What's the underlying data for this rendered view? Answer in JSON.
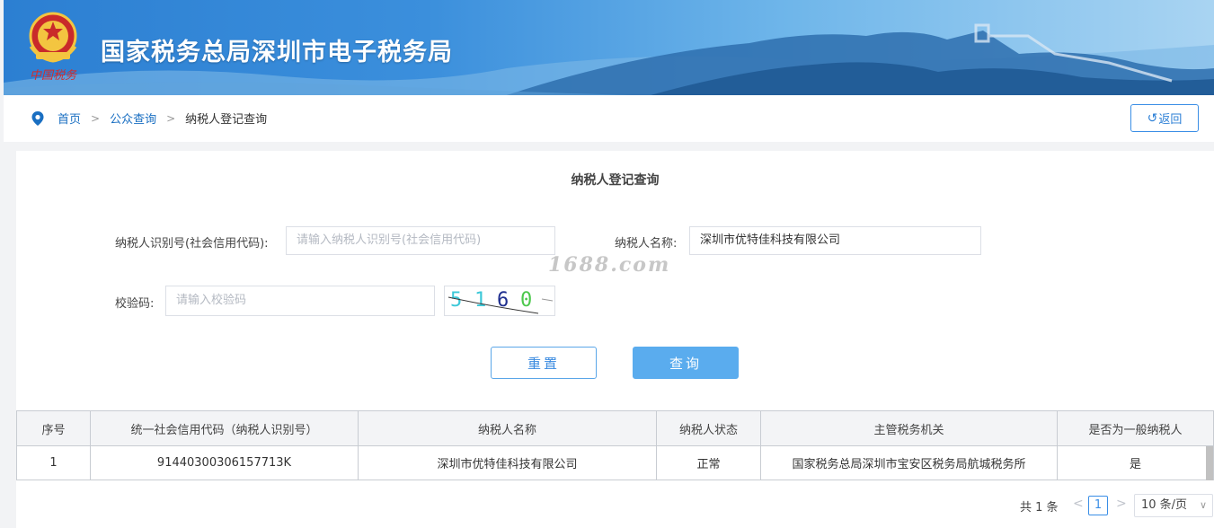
{
  "header": {
    "title": "国家税务总局深圳市电子税务局",
    "logo_caption": "中国税务"
  },
  "breadcrumb": {
    "home": "首页",
    "sep": ">",
    "public_query": "公众查询",
    "current": "纳税人登记查询",
    "back_label": "返回",
    "back_icon": "↺"
  },
  "form": {
    "title": "纳税人登记查询",
    "taxpayer_id_label": "纳税人识别号(社会信用代码):",
    "taxpayer_id_placeholder": "请输入纳税人识别号(社会信用代码)",
    "taxpayer_name_label": "纳税人名称:",
    "taxpayer_name_value": "深圳市优特佳科技有限公司",
    "captcha_label": "校验码:",
    "captcha_placeholder": "请输入校验码",
    "captcha_chars": [
      "5",
      "1",
      "6",
      "0"
    ],
    "captcha_colors": [
      "#3cc8d8",
      "#3cc8d8",
      "#1f2f8f",
      "#4cc84c"
    ],
    "reset_label": "重置",
    "query_label": "查询"
  },
  "watermark": "1688.com",
  "table": {
    "headers": [
      "序号",
      "统一社会信用代码（纳税人识别号）",
      "纳税人名称",
      "纳税人状态",
      "主管税务机关",
      "是否为一般纳税人"
    ],
    "rows": [
      [
        "1",
        "91440300306157713K",
        "深圳市优特佳科技有限公司",
        "正常",
        "国家税务总局深圳市宝安区税务局航城税务所",
        "是"
      ]
    ]
  },
  "pagination": {
    "total": "共 1 条",
    "prev": "<",
    "page": "1",
    "next": ">",
    "page_size": "10 条/页"
  },
  "colors": {
    "primary": "#3a8ee6",
    "query_button": "#5aacee",
    "link": "#1a6fc2"
  }
}
